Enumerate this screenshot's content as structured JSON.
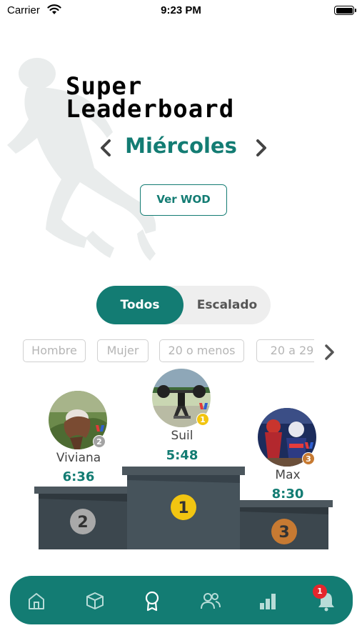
{
  "status_bar": {
    "carrier": "Carrier",
    "time": "9:23 PM"
  },
  "header": {
    "title_line1": "Super",
    "title_line2": "Leaderboard"
  },
  "day_nav": {
    "day": "Miércoles",
    "prev_icon": "chevron-left-icon",
    "next_icon": "chevron-right-icon"
  },
  "wod_button": {
    "label": "Ver WOD"
  },
  "segmented": {
    "options": [
      "Todos",
      "Escalado"
    ],
    "selected": "Todos"
  },
  "filters": {
    "chips": [
      "Hombre",
      "Mujer",
      "20 o menos",
      "20 a 29"
    ],
    "more_icon": "chevron-right-icon"
  },
  "podium": {
    "first": {
      "name": "Suil",
      "time": "5:48",
      "rank": "1"
    },
    "second": {
      "name": "Viviana",
      "time": "6:36",
      "rank": "2"
    },
    "third": {
      "name": "Max",
      "time": "8:30",
      "rank": "3"
    }
  },
  "colors": {
    "accent": "#137c73",
    "gold": "#f2c511",
    "silver": "#a3a3a3",
    "bronze": "#c77a32",
    "podium": "#3c474e",
    "notification": "#e5262c"
  },
  "tabbar": {
    "items": [
      "home-icon",
      "box-icon",
      "medal-icon",
      "users-icon",
      "stats-icon",
      "bell-icon"
    ],
    "active": "medal-icon",
    "notification_count": "1"
  }
}
